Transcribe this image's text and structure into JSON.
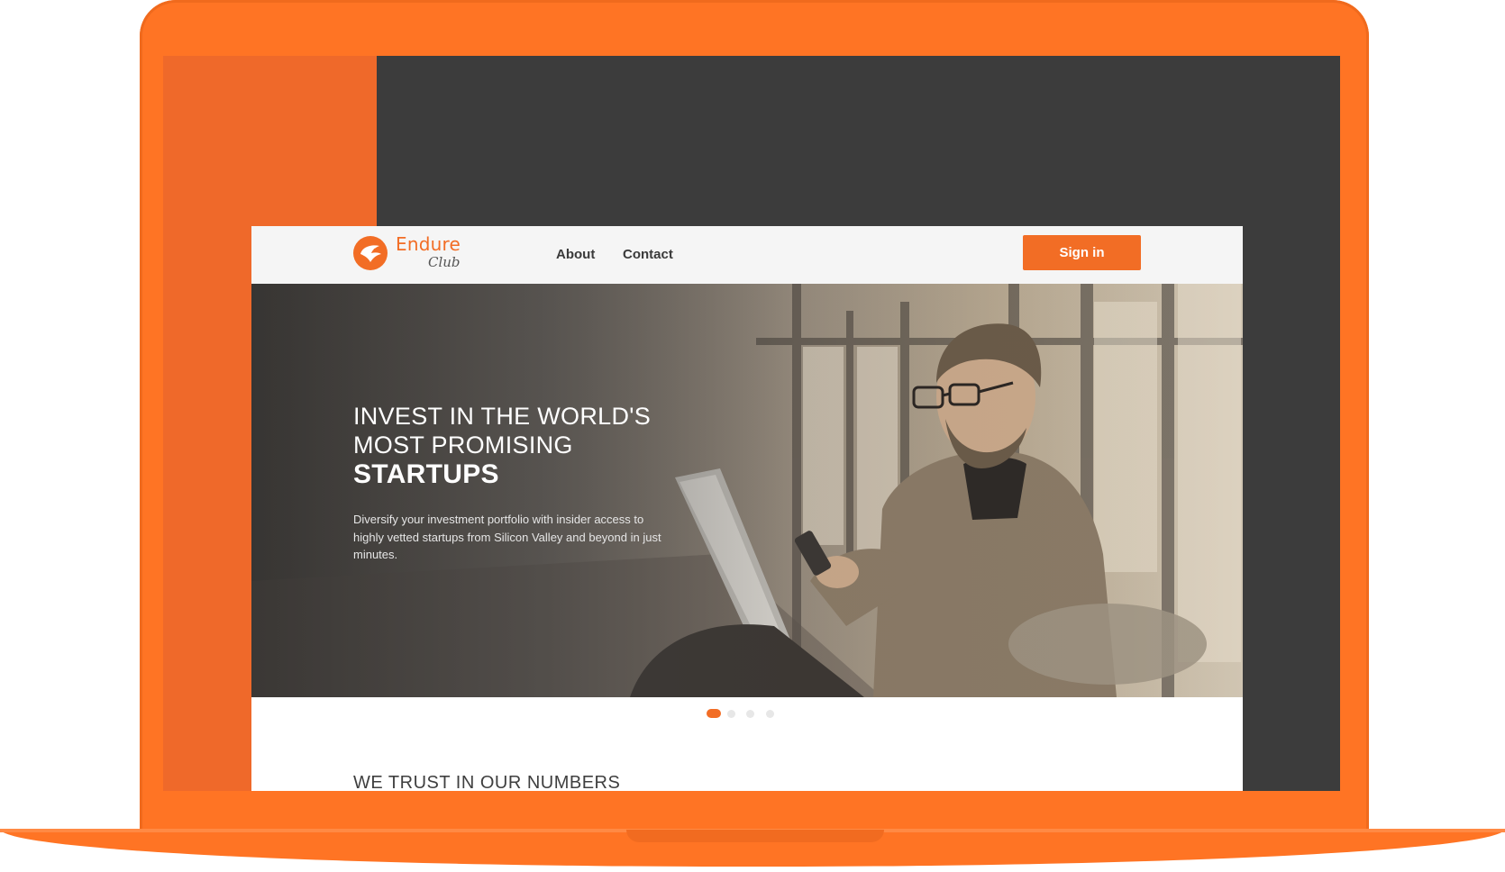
{
  "site": {
    "logo": {
      "name": "Endure",
      "sub": "Club"
    },
    "nav": {
      "about": "About",
      "contact": "Contact"
    },
    "signin": "Sign in",
    "hero": {
      "line1": "INVEST IN THE WORLD'S",
      "line2": "MOST PROMISING",
      "line3": "STARTUPS",
      "description": "Diversify your investment portfolio with insider access to highly vetted startups from Silicon Valley and beyond in just minutes."
    },
    "pager": {
      "count": 4,
      "active": 1
    },
    "numbers_heading": "WE TRUST IN OUR NUMBERS"
  },
  "colors": {
    "laptop": "#ff7424",
    "accent": "#f26d25",
    "screen": "#3c3c3c"
  },
  "icons": [
    "logo-bird-icon"
  ]
}
